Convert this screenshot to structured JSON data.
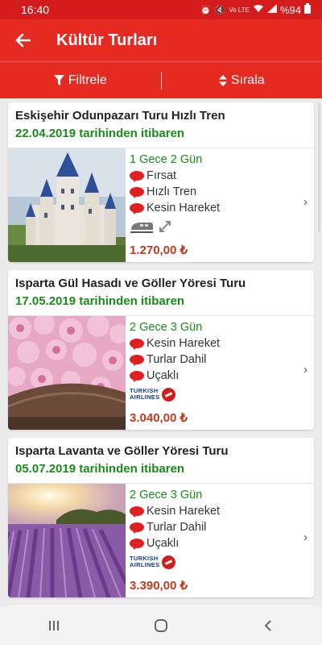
{
  "status_bar": {
    "time": "16:40",
    "network": "Vo LTE",
    "battery": "%94"
  },
  "app_bar": {
    "back_icon": "arrow-left-icon",
    "title": "Kültür Turları"
  },
  "toolbar": {
    "filter_label": "Filtrele",
    "sort_label": "Sırala"
  },
  "tours": [
    {
      "title": "Eskişehir Odunpazarı Turu Hızlı Tren",
      "date": "22.04.2019 tarihinden itibaren",
      "duration": "1 Gece 2 Gün",
      "features": [
        "Fırsat",
        "Hızlı Tren",
        "Kesin Hareket"
      ],
      "transport": "train",
      "price": "1.270,00 ₺"
    },
    {
      "title": "Isparta Gül Hasadı ve Göller Yöresi Turu",
      "date": "17.05.2019 tarihinden itibaren",
      "duration": "2 Gece 3 Gün",
      "features": [
        "Kesin Hareket",
        "Turlar Dahil",
        "Uçaklı"
      ],
      "transport": "plane",
      "price": "3.040,00 ₺"
    },
    {
      "title": "Isparta Lavanta ve Göller Yöresi Turu",
      "date": "05.07.2019 tarihinden itibaren",
      "duration": "2 Gece 3 Gün",
      "features": [
        "Kesin Hareket",
        "Turlar Dahil",
        "Uçaklı"
      ],
      "transport": "plane",
      "price": "3.390,00 ₺"
    }
  ],
  "airline_logo_text": [
    "TURKISH",
    "AIRLINES"
  ],
  "colors": {
    "primary": "#e52a22",
    "status_bar": "#d51c1c",
    "date_green": "#1a8a1a",
    "price": "#c03a1d"
  }
}
